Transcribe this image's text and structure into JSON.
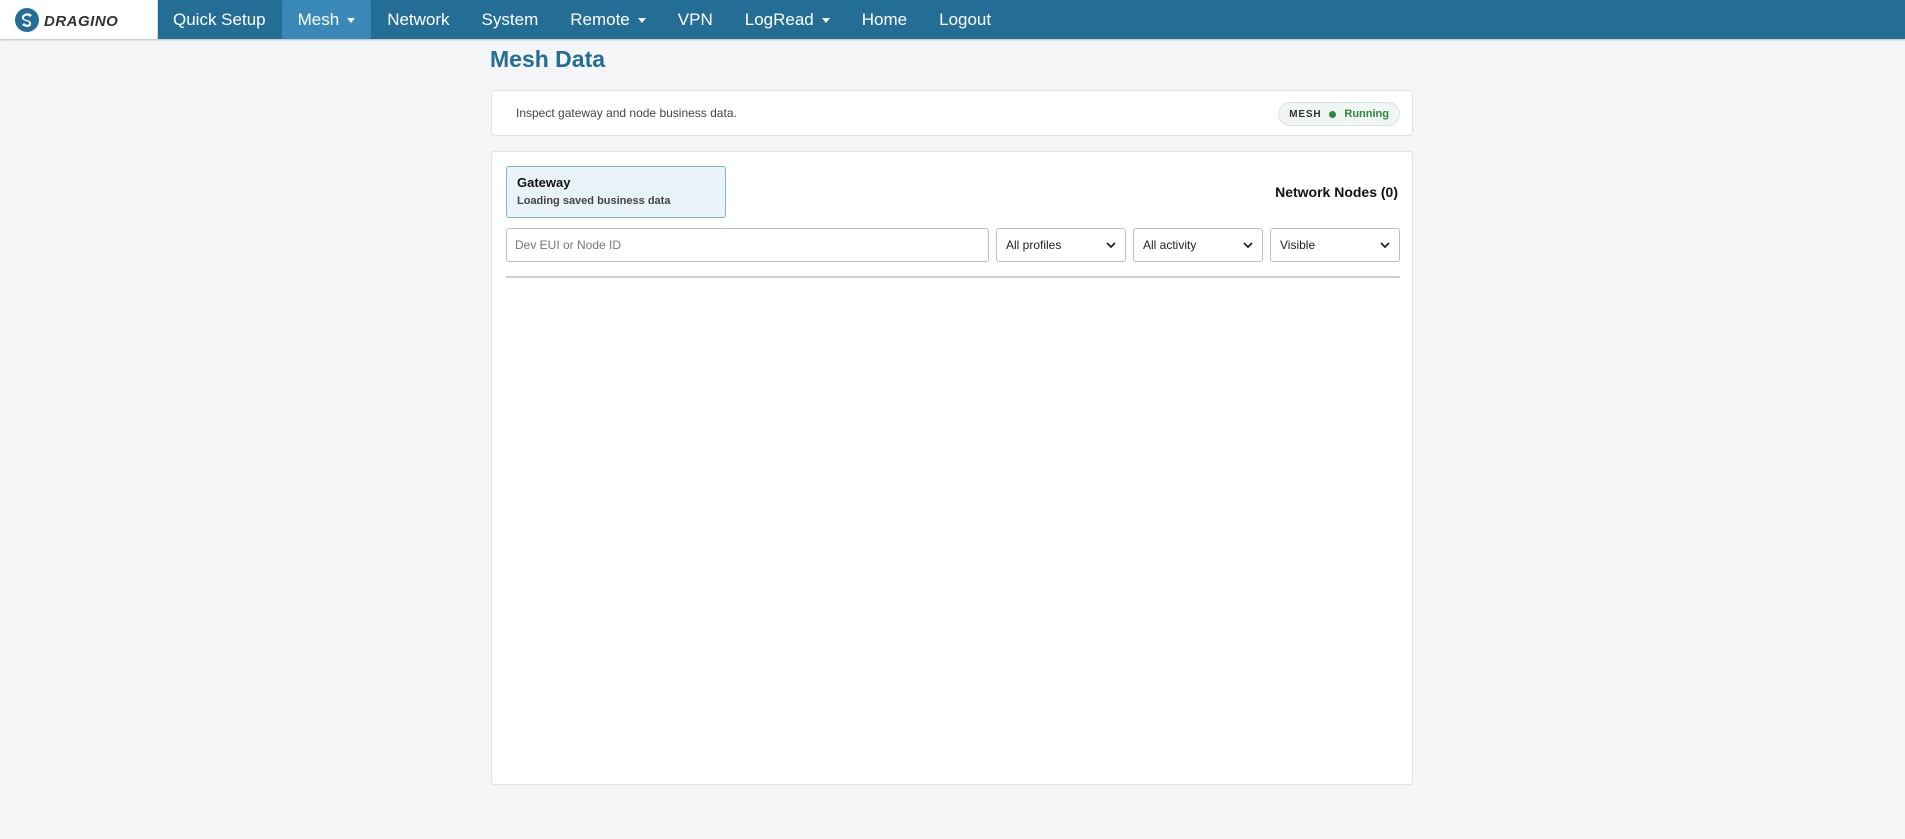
{
  "brand": {
    "name": "DRAGINO"
  },
  "nav": {
    "items": [
      {
        "label": "Quick Setup",
        "dropdown": false
      },
      {
        "label": "Mesh",
        "dropdown": true,
        "active": true
      },
      {
        "label": "Network",
        "dropdown": false
      },
      {
        "label": "System",
        "dropdown": false
      },
      {
        "label": "Remote",
        "dropdown": true
      },
      {
        "label": "VPN",
        "dropdown": false
      },
      {
        "label": "LogRead",
        "dropdown": true
      },
      {
        "label": "Home",
        "dropdown": false
      },
      {
        "label": "Logout",
        "dropdown": false
      }
    ]
  },
  "page": {
    "title": "Mesh Data"
  },
  "info": {
    "description": "Inspect gateway and node business data.",
    "badge_label": "MESH",
    "status": "Running"
  },
  "gateway": {
    "title": "Gateway",
    "subtitle": "Loading saved business data"
  },
  "nodes": {
    "heading": "Network Nodes (0)"
  },
  "filters": {
    "search_placeholder": "Dev EUI or Node ID",
    "search_value": "",
    "profile": "All profiles",
    "activity": "All activity",
    "visibility": "Visible"
  },
  "colors": {
    "nav_bg": "#246e96",
    "nav_active": "#3a88b8",
    "title": "#246e96",
    "status_green": "#2a8a3e"
  }
}
